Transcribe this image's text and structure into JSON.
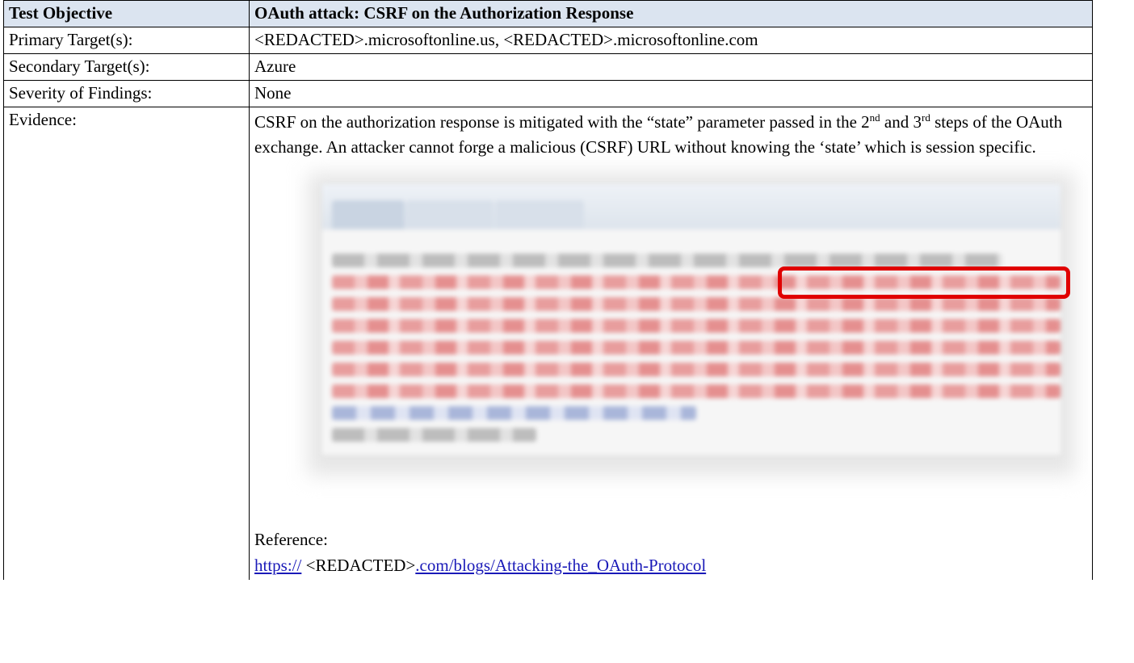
{
  "header": {
    "label": "Test Objective",
    "title": "OAuth attack: CSRF on the Authorization Response"
  },
  "rows": {
    "primary": {
      "label": "Primary Target(s):",
      "value": "<REDACTED>.microsoftonline.us, <REDACTED>.microsoftonline.com"
    },
    "secondary": {
      "label": "Secondary Target(s):",
      "value": "Azure"
    },
    "severity": {
      "label": "Severity of Findings:",
      "value": "None"
    },
    "evidence": {
      "label": "Evidence:",
      "text_part1": "CSRF on the authorization response is mitigated with the “state” parameter passed in the ",
      "step2_num": "2",
      "step2_sup": "nd",
      "text_and": " and ",
      "step3_num": "3",
      "step3_sup": "rd",
      "text_part2": " steps of the OAuth exchange. An attacker cannot forge a malicious (CSRF) URL without knowing the ‘state’ which is session specific.",
      "reference_label": "Reference:",
      "reference_link_start": "https://",
      "reference_redacted": " <REDACTED>",
      "reference_link_end": ".com/blogs/Attacking-the_OAuth-Protocol"
    }
  },
  "colors": {
    "header_background": "#dbe4f0",
    "link": "#1a1ab8",
    "highlight": "#e00000"
  }
}
